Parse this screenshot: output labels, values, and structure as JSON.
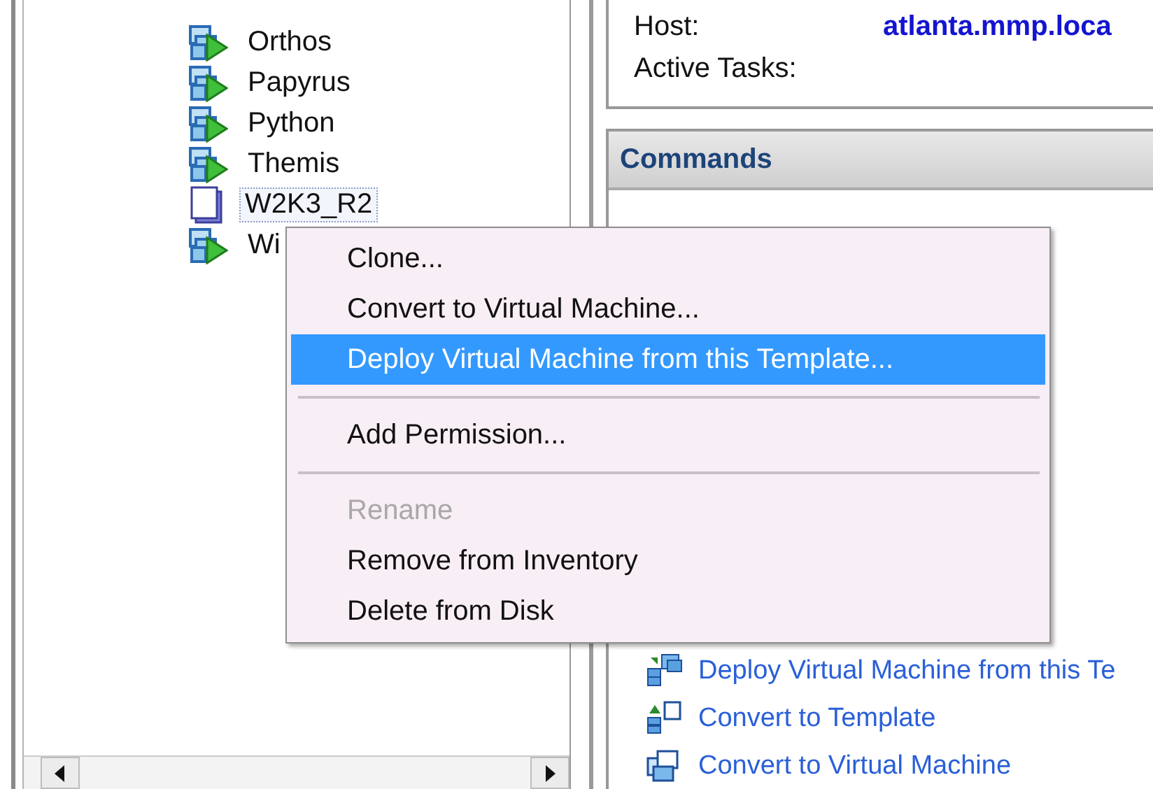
{
  "tree": {
    "items": [
      {
        "label": "Orthos",
        "kind": "vm",
        "selected": false
      },
      {
        "label": "Papyrus",
        "kind": "vm",
        "selected": false
      },
      {
        "label": "Python",
        "kind": "vm",
        "selected": false
      },
      {
        "label": "Themis",
        "kind": "vm",
        "selected": false
      },
      {
        "label": "W2K3_R2",
        "kind": "template",
        "selected": true
      },
      {
        "label": "Wi",
        "kind": "vm",
        "selected": false
      }
    ]
  },
  "summary": {
    "rows": [
      {
        "label": "Host:",
        "value": "atlanta.mmp.loca"
      },
      {
        "label": "Active Tasks:"
      }
    ]
  },
  "commands": {
    "title": "Commands",
    "items": [
      {
        "label": "Deploy Virtual Machine from this Te",
        "kind": "deploy"
      },
      {
        "label": "Convert to Template",
        "kind": "to-template"
      },
      {
        "label": "Convert to Virtual Machine",
        "kind": "to-vm"
      }
    ]
  },
  "context_menu": {
    "items": [
      {
        "kind": "item",
        "label": "Clone...",
        "selected": false,
        "disabled": false
      },
      {
        "kind": "item",
        "label": "Convert to Virtual Machine...",
        "selected": false,
        "disabled": false
      },
      {
        "kind": "item",
        "label": "Deploy Virtual Machine from this Template...",
        "selected": true,
        "disabled": false
      },
      {
        "kind": "separator"
      },
      {
        "kind": "item",
        "label": "Add Permission...",
        "selected": false,
        "disabled": false
      },
      {
        "kind": "separator"
      },
      {
        "kind": "item",
        "label": "Rename",
        "selected": false,
        "disabled": true
      },
      {
        "kind": "item",
        "label": "Remove from Inventory",
        "selected": false,
        "disabled": false
      },
      {
        "kind": "item",
        "label": "Delete from Disk",
        "selected": false,
        "disabled": false
      }
    ]
  }
}
